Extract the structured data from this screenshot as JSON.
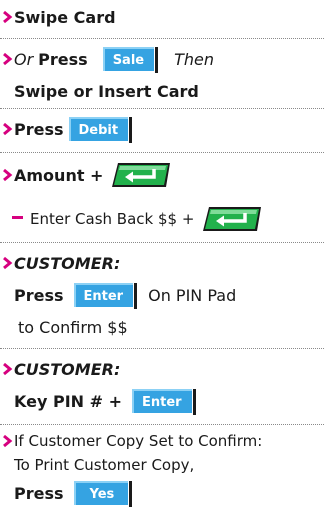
{
  "steps": [
    {
      "text": "Swipe Card"
    },
    {
      "or": "Or",
      "press": "Press",
      "key": "Sale",
      "then": "Then",
      "line2": "Swipe or Insert Card"
    },
    {
      "press": "Press",
      "key": "Debit"
    },
    {
      "text": "Amount +",
      "key_icon": "enter-arrow-icon"
    },
    {
      "text": "Enter Cash Back $$ +",
      "key_icon": "enter-arrow-icon"
    },
    {
      "who": "CUSTOMER:",
      "press": "Press",
      "key": "Enter",
      "rest": "On PIN Pad",
      "line3": "to Confirm $$"
    },
    {
      "who": "CUSTOMER:",
      "text": "Key PIN # +",
      "key": "Enter"
    },
    {
      "line1": "If Customer Copy Set to Confirm:",
      "line2": "To Print Customer Copy,",
      "press": "Press",
      "key": "Yes"
    }
  ],
  "colors": {
    "accent_magenta": "#d6007f",
    "key_blue": "#35a3e2",
    "enter_green": "#22b14c",
    "divider_gray": "#8a8a8a"
  }
}
